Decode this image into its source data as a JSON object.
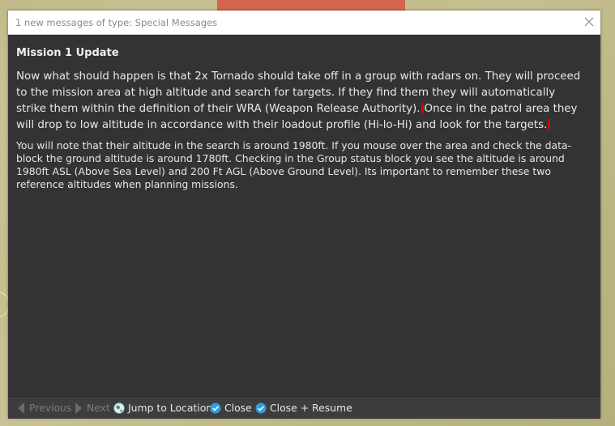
{
  "dialog": {
    "title": "1 new messages of type: Special Messages",
    "close_icon": "close-icon"
  },
  "message": {
    "heading": "Mission 1 Update",
    "para1": {
      "part1": "Now what should happen is that 2x Tornado should take off in a group with radars on.  They will proceed to the mission area at high altitude and search for targets.  If they find them they will automatically strike them within the definition of their WRA (Weapon Release Authority).",
      "part2": "Once in the patrol area they will drop to low altitude in accordance with their loadout profile (Hi-lo-Hi) and look for the targets."
    },
    "para2": "You will note that their altitude in the search is around 1980ft.  If you mouse over the area and check the data-block the ground altitude is around 1780ft.  Checking in the Group status block you see the altitude is around 1980ft ASL (Above Sea Level) and 200 Ft AGL (Above Ground Level). Its important to remember these two reference altitudes when planning missions."
  },
  "footer": {
    "previous": "Previous",
    "next": "Next",
    "jump": "Jump to Location",
    "close": "Close",
    "close_resume": "Close + Resume"
  },
  "colors": {
    "dialog_bg": "#333333",
    "check_icon": "#2f9fe0",
    "annotation_mark": "#e00000"
  }
}
